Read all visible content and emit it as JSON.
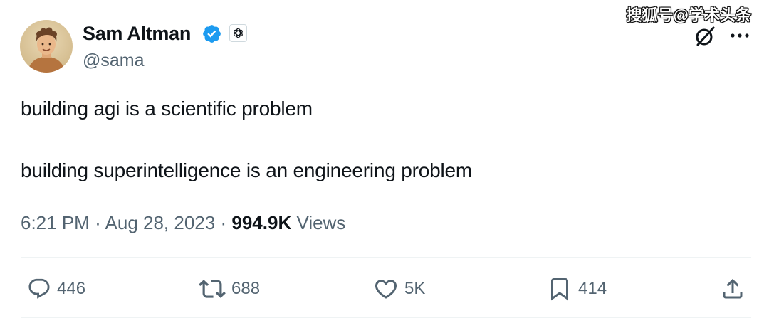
{
  "watermark": "搜狐号@学术头条",
  "author": {
    "display_name": "Sam Altman",
    "handle": "@sama",
    "verified": true,
    "affiliation": "OpenAI"
  },
  "tweet": {
    "lines": [
      "building agi is a scientific problem",
      "building superintelligence is an engineering problem"
    ],
    "time": "6:21 PM",
    "separator": "·",
    "date": "Aug 28, 2023",
    "views_count": "994.9K",
    "views_label": "Views"
  },
  "actions": {
    "replies": "446",
    "retweets": "688",
    "likes": "5K",
    "bookmarks": "414"
  },
  "colors": {
    "text_primary": "#0f1419",
    "text_secondary": "#536471",
    "verified_blue": "#1d9bf0",
    "divider": "#eff3f4"
  }
}
